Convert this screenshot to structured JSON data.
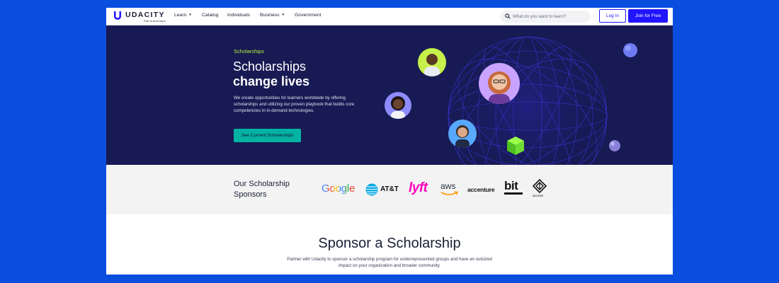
{
  "nav": {
    "brand": "UDACITY",
    "brand_sub": "Part of Accenture",
    "links": [
      {
        "label": "Learn",
        "dropdown": true
      },
      {
        "label": "Catalog",
        "dropdown": false
      },
      {
        "label": "Individuals",
        "dropdown": false
      },
      {
        "label": "Business",
        "dropdown": true
      },
      {
        "label": "Government",
        "dropdown": false
      }
    ],
    "search_placeholder": "What do you want to learn?",
    "login_label": "Log In",
    "join_label": "Join for Free"
  },
  "hero": {
    "eyebrow": "Scholarships",
    "title_line1": "Scholarships",
    "title_line2": "change lives",
    "description": "We create opportunities for learners worldwide by offering scholarships and utilizing our proven playbook that builds core competencies in in-demand technologies.",
    "cta_label": "See Current Scholarships"
  },
  "sponsors": {
    "title": "Our Scholarship Sponsors",
    "logos": [
      {
        "name": "Google",
        "text": "Google"
      },
      {
        "name": "AT&T",
        "text": "AT&T"
      },
      {
        "name": "Lyft",
        "text": "lyft"
      },
      {
        "name": "AWS",
        "text": "aws"
      },
      {
        "name": "Accenture",
        "text": "accenture"
      },
      {
        "name": "bit",
        "text": "bit"
      },
      {
        "name": "access",
        "text": "access"
      }
    ]
  },
  "sponsor_section": {
    "title": "Sponsor a Scholarship",
    "description": "Partner with Udacity to sponsor a scholarship program for underrepresented groups and have an outsized impact on your organization and broader community."
  },
  "colors": {
    "page_bg": "#0a4ee0",
    "brand_blue": "#2015ff",
    "hero_bg": "#171a53",
    "accent_green": "#b7f43b",
    "cta_teal": "#02b3a4"
  }
}
